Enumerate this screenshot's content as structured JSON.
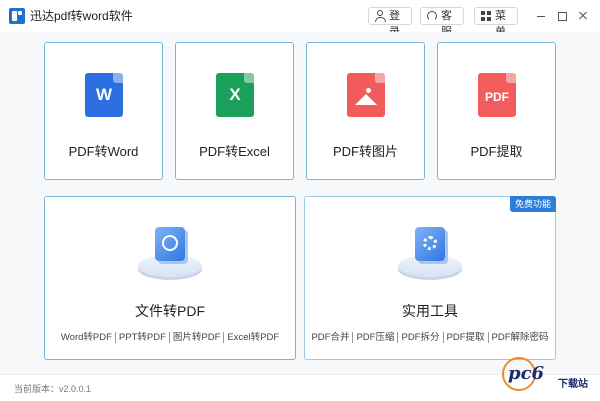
{
  "window": {
    "title": "迅达pdf转word软件",
    "buttons": {
      "login": "登录",
      "service": "客服",
      "menu": "菜单"
    }
  },
  "cards": {
    "word": {
      "icon_text": "W",
      "label": "PDF转Word"
    },
    "excel": {
      "icon_text": "X",
      "label": "PDF转Excel"
    },
    "image": {
      "label": "PDF转图片"
    },
    "pdf": {
      "icon_text": "PDF",
      "label": "PDF提取"
    }
  },
  "file_convert": {
    "title": "文件转PDF",
    "links": [
      "Word转PDF",
      "PPT转PDF",
      "图片转PDF",
      "Excel转PDF"
    ]
  },
  "tools": {
    "title": "实用工具",
    "badge": "免费功能",
    "links": [
      "PDF合并",
      "PDF压缩",
      "PDF拆分",
      "PDF提取",
      "PDF解除密码"
    ]
  },
  "status": {
    "version": "当前版本：v2.0.0.1"
  },
  "watermark": {
    "logo_text": "pc6",
    "sub_text": "下载站"
  },
  "colors": {
    "word": "#2b6fe0",
    "excel": "#1aa05a",
    "image": "#f15b5b",
    "pdf": "#f25c5c",
    "card_border": "#7ab5d9",
    "badge": "#2b7fd8"
  }
}
